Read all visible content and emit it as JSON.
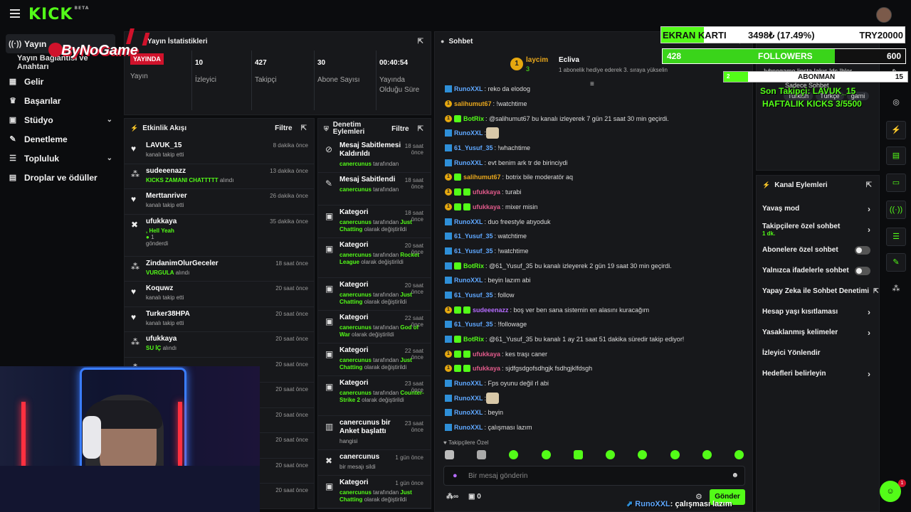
{
  "brand": {
    "logo": "KICK",
    "beta": "BETA"
  },
  "sidebar": {
    "items": [
      {
        "label": "Yayın",
        "icon": "broadcast-icon"
      },
      {
        "label": "Yayın Bağlantısı ve Anahtarı"
      },
      {
        "label": "Gelir",
        "icon": "revenue-icon"
      },
      {
        "label": "Başarılar",
        "icon": "trophy-icon"
      },
      {
        "label": "Stüdyo",
        "icon": "studio-icon"
      },
      {
        "label": "Denetleme",
        "icon": "wrench-icon"
      },
      {
        "label": "Topluluk",
        "icon": "community-icon"
      },
      {
        "label": "Droplar ve ödüller",
        "icon": "drops-icon"
      }
    ]
  },
  "stats": {
    "title": "Yayın İstatistikleri",
    "live_badge": "YAYINDA",
    "live_label": "Yayın",
    "viewers": "10",
    "viewers_label": "İzleyici",
    "followers": "427",
    "followers_label": "Takipçi",
    "subs": "30",
    "subs_label": "Abone Sayısı",
    "duration": "00:40:54",
    "duration_label": "Yayında Olduğu Süre"
  },
  "activity": {
    "title": "Etkinlik Akışı",
    "filter": "Filtre",
    "items": [
      {
        "name": "LAVUK_15",
        "sub": "kanalı takip etti",
        "time": "8 dakika önce"
      },
      {
        "name": "sudeeenazz",
        "sub": "KICKS ZAMANI CHATTTTT",
        "sub2": " alındı",
        "time": "13 dakika önce"
      },
      {
        "name": "Merttanriver",
        "sub": "kanalı takip etti",
        "time": "26 dakika önce"
      },
      {
        "name": "ufukkaya",
        "sub": ", Hell Yeah",
        "sub2": "1",
        "sub3": "gönderdi",
        "time": "35 dakika önce"
      },
      {
        "name": "ZindanimOlurGeceler",
        "sub": "VURGULA",
        "sub2": " alındı",
        "time": "18 saat önce"
      },
      {
        "name": "Koquwz",
        "sub": "kanalı takip etti",
        "time": "20 saat önce"
      },
      {
        "name": "Turker38HPA",
        "sub": "kanalı takip etti",
        "time": "20 saat önce"
      },
      {
        "name": "ufukkaya",
        "sub": "SU İÇ",
        "sub2": " alındı",
        "time": "20 saat önce"
      },
      {
        "name": "",
        "sub": "",
        "time": "20 saat önce"
      },
      {
        "name": "",
        "sub": "",
        "time": "20 saat önce"
      },
      {
        "name": "",
        "sub": "",
        "time": "20 saat önce"
      },
      {
        "name": "",
        "sub": "",
        "time": "20 saat önce"
      },
      {
        "name": "",
        "sub": "",
        "time": "20 saat önce"
      },
      {
        "name": "",
        "sub": "",
        "time": "20 saat önce"
      }
    ]
  },
  "moderation": {
    "title": "Denetim Eylemleri",
    "filter": "Filtre",
    "items": [
      {
        "name": "Mesaj Sabitlemesi Kaldırıldı",
        "by": "canercunus",
        "rest": " tarafından",
        "time": "18 saat önce"
      },
      {
        "name": "Mesaj Sabitlendi",
        "by": "canercunus",
        "rest": " tarafından",
        "time": "18 saat önce"
      },
      {
        "name": "Kategori",
        "by": "canercunus",
        "rest": " tarafından ",
        "cat": "Just Chatting",
        "rest2": " olarak değiştirildi",
        "time": "18 saat önce"
      },
      {
        "name": "Kategori",
        "by": "canercunus",
        "rest": " tarafından ",
        "cat": "Rocket League",
        "rest2": " olarak değiştirildi",
        "time": "20 saat önce"
      },
      {
        "name": "Kategori",
        "by": "canercunus",
        "rest": " tarafından ",
        "cat": "Just Chatting",
        "rest2": " olarak değiştirildi",
        "time": "20 saat önce"
      },
      {
        "name": "Kategori",
        "by": "canercunus",
        "rest": " tarafından ",
        "cat": "God of War",
        "rest2": " olarak değiştirildi",
        "time": "22 saat önce"
      },
      {
        "name": "Kategori",
        "by": "canercunus",
        "rest": " tarafından ",
        "cat": "Just Chatting",
        "rest2": " olarak değiştirildi",
        "time": "22 saat önce"
      },
      {
        "name": "Kategori",
        "by": "canercunus",
        "rest": " tarafından ",
        "cat": "Counter-Strike 2",
        "rest2": " olarak değiştirildi",
        "time": "23 saat önce"
      },
      {
        "name": "canercunus bir Anket başlattı",
        "by": "",
        "rest": "hangisi",
        "time": "23 saat önce"
      },
      {
        "name": "canercunus",
        "by": "",
        "rest": "bir mesajı sildi",
        "time": "1 gün önce"
      },
      {
        "name": "Kategori",
        "by": "canercunus",
        "rest": " tarafından ",
        "cat": "Just Chatting",
        "rest2": " olarak değiştirildi",
        "time": "1 gün önce"
      }
    ]
  },
  "chat": {
    "title": "Sohbet",
    "pinned_user1": "laycim",
    "pinned_user1_count": "3",
    "pinned_user2": "Ecliva",
    "pinned_msg": "1 abonelik hediye ederek 3. sıraya yükselin",
    "followers_only": "Takipçilere Özel",
    "input_placeholder": "Bir mesaj gönderin",
    "send": "Gönder",
    "points": "0",
    "messages": [
      {
        "user": "RunoXXL",
        "color": "#5fa8ff",
        "badge": "b",
        "text": ": reko da elodog"
      },
      {
        "user": "salihumut67",
        "color": "#e8a71c",
        "badge": "s",
        "text": ": !watchtime"
      },
      {
        "user": "BotRix",
        "color": "#53fc18",
        "badge": "sg",
        "text": ": @salihumut67 bu kanalı izleyerek 7 gün 21 saat 30 min geçirdi."
      },
      {
        "user": "RunoXXL",
        "color": "#5fa8ff",
        "badge": "b",
        "text": ": [emote]"
      },
      {
        "user": "61_Yusuf_35",
        "color": "#5fa8ff",
        "badge": "b",
        "text": ": !whachtime"
      },
      {
        "user": "RunoXXL",
        "color": "#5fa8ff",
        "badge": "b",
        "text": ": evt benim ark tr de birinciydi"
      },
      {
        "user": "salihumut67",
        "color": "#e8a71c",
        "badge": "sg",
        "text": ": botrix bile moderatör aq"
      },
      {
        "user": "ufukkaya",
        "color": "#e05a8a",
        "badge": "sgg",
        "text": ": turabi"
      },
      {
        "user": "ufukkaya",
        "color": "#e05a8a",
        "badge": "sgg",
        "text": ": mixer misin"
      },
      {
        "user": "RunoXXL",
        "color": "#5fa8ff",
        "badge": "b",
        "text": ": duo freestyle atıyoduk"
      },
      {
        "user": "61_Yusuf_35",
        "color": "#5fa8ff",
        "badge": "b",
        "text": ": watchtime"
      },
      {
        "user": "61_Yusuf_35",
        "color": "#5fa8ff",
        "badge": "b",
        "text": ": !watchtime"
      },
      {
        "user": "BotRix",
        "color": "#53fc18",
        "badge": "bg",
        "text": ": @61_Yusuf_35 bu kanalı izleyerek 2 gün 19 saat 30 min geçirdi."
      },
      {
        "user": "RunoXXL",
        "color": "#5fa8ff",
        "badge": "b",
        "text": ": beyin lazım abi"
      },
      {
        "user": "61_Yusuf_35",
        "color": "#5fa8ff",
        "badge": "b",
        "text": ": follow"
      },
      {
        "user": "sudeeenazz",
        "color": "#b56cff",
        "badge": "sgg",
        "text": ": boş ver ben sana sistemin en alasını kuracağım"
      },
      {
        "user": "61_Yusuf_35",
        "color": "#5fa8ff",
        "badge": "b",
        "text": ": !followage"
      },
      {
        "user": "BotRix",
        "color": "#53fc18",
        "badge": "bg",
        "text": ": @61_Yusuf_35 bu kanalı 1 ay 21 saat 51 dakika süredir takip ediyor!"
      },
      {
        "user": "ufukkaya",
        "color": "#e05a8a",
        "badge": "sgg",
        "text": ": kes traşı caner"
      },
      {
        "user": "ufukkaya",
        "color": "#e05a8a",
        "badge": "sgg",
        "text": ": sjdfgsdgofsdhgjk fsdhgjklfdsgh"
      },
      {
        "user": "RunoXXL",
        "color": "#5fa8ff",
        "badge": "b",
        "text": ": Fps oyunu değil rl abi"
      },
      {
        "user": "RunoXXL",
        "color": "#5fa8ff",
        "badge": "b",
        "text": ": [emote]"
      },
      {
        "user": "RunoXXL",
        "color": "#5fa8ff",
        "badge": "b",
        "text": ": beyin"
      },
      {
        "user": "RunoXXL",
        "color": "#5fa8ff",
        "badge": "b",
        "text": ": çalışması lazım"
      }
    ]
  },
  "channel_actions": {
    "title": "Kanal Eylemleri",
    "items": [
      {
        "label": "Yavaş mod",
        "type": "arrow"
      },
      {
        "label": "Takipçilere özel sohbet",
        "sub": "1 dk.",
        "type": "arrow"
      },
      {
        "label": "Abonelere özel sohbet",
        "type": "toggle"
      },
      {
        "label": "Yalnızca ifadelerle sohbet",
        "type": "toggle"
      },
      {
        "label": "Yapay Zeka ile Sohbet Denetimi",
        "type": "ext"
      },
      {
        "label": "Hesap yaşı kısıtlaması",
        "type": "arrow"
      },
      {
        "label": "Yasaklanmış kelimeler",
        "type": "arrow"
      },
      {
        "label": "İzleyici Yönlendir",
        "type": "none"
      },
      {
        "label": "Hedefleri belirleyin",
        "type": "arrow"
      }
    ]
  },
  "stream_info": {
    "line1": "!ybnogame linsta !akış !dc !bler...",
    "line2": "Sadece Sohbet",
    "tag1": "Turkish",
    "tag2": "Türkçe",
    "tag3": "gami"
  },
  "overlay": {
    "gpu_label": "EKRAN KARTI",
    "gpu_value": "3498₺ (17.49%)",
    "gpu_goal": "TRY20000",
    "gpu_progress": 0.1749,
    "followers_current": "428",
    "followers_label": "FOLLOWERS",
    "followers_goal": "600",
    "followers_progress": 0.71,
    "subs_current": "2",
    "subs_label": "ABONMAN",
    "subs_goal": "15",
    "subs_progress": 0.13,
    "last_follower": "Son Takipçi: LAVUK_15",
    "weekly_kicks": "HAFTALIK KICKS 3/5500",
    "streamer_logo": "ByNoGame",
    "chat_ticker_user": "RunoXXL",
    "chat_ticker_text": ": çalışması lazım"
  },
  "colors": {
    "accent": "#53fc18",
    "live": "#d0122b",
    "panel": "#17181b"
  }
}
